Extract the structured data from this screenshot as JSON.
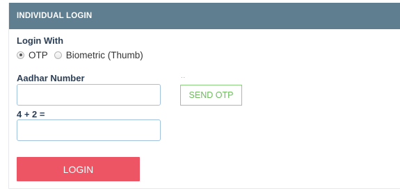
{
  "panel": {
    "title": "INDIVIDUAL LOGIN"
  },
  "login_with": {
    "label": "Login With",
    "options": [
      {
        "label": "OTP",
        "selected": true
      },
      {
        "label": "Biometric (Thumb)",
        "selected": false
      }
    ]
  },
  "aadhar": {
    "label": "Aadhar Number",
    "value": "",
    "helper_text": ".."
  },
  "send_otp": {
    "label": "SEND OTP"
  },
  "captcha": {
    "question": "4 + 2 =",
    "value": ""
  },
  "login_button": {
    "label": "LOGIN"
  },
  "colors": {
    "header_bg": "#5f7e8f",
    "login_button": "#ed5565",
    "send_otp_border": "#8ccf80",
    "input_border": "#9fc1de"
  }
}
